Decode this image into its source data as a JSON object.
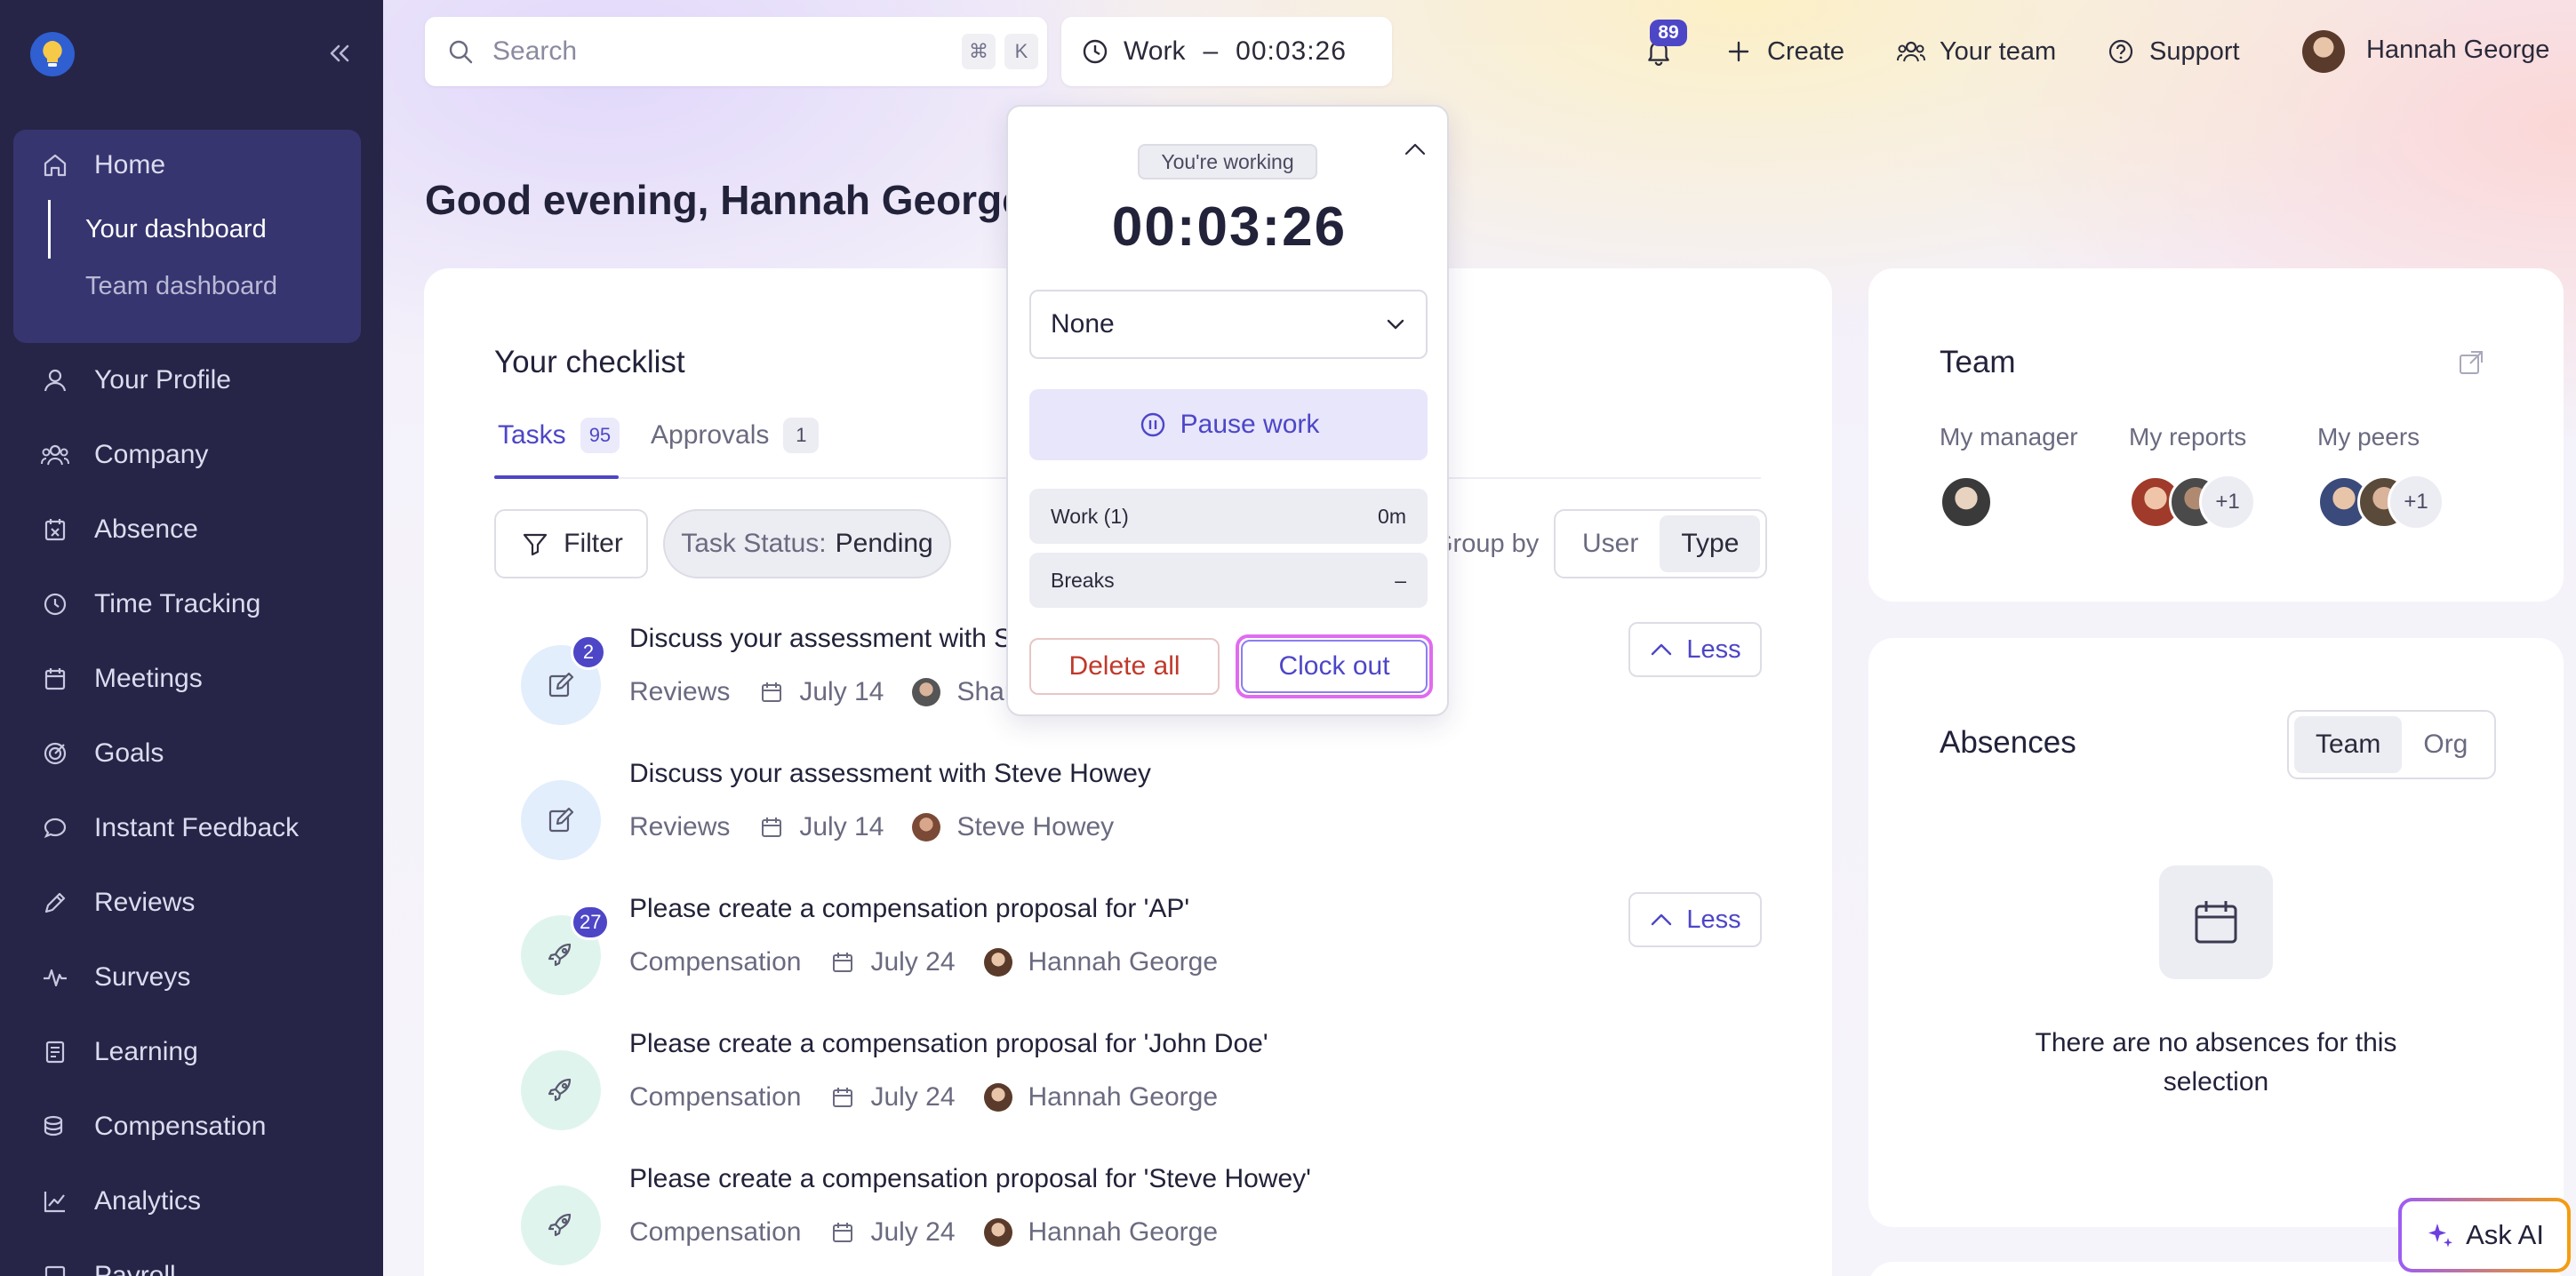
{
  "sidebar": {
    "items": [
      {
        "label": "Home",
        "icon": "home-icon"
      },
      {
        "label": "Your Profile",
        "icon": "user-icon"
      },
      {
        "label": "Company",
        "icon": "users-icon"
      },
      {
        "label": "Absence",
        "icon": "calendar-x-icon"
      },
      {
        "label": "Time Tracking",
        "icon": "clock-icon"
      },
      {
        "label": "Meetings",
        "icon": "calendar-icon"
      },
      {
        "label": "Goals",
        "icon": "target-icon"
      },
      {
        "label": "Instant Feedback",
        "icon": "chat-bubble-icon"
      },
      {
        "label": "Reviews",
        "icon": "pencil-icon"
      },
      {
        "label": "Surveys",
        "icon": "pulse-icon"
      },
      {
        "label": "Learning",
        "icon": "book-icon"
      },
      {
        "label": "Compensation",
        "icon": "coins-icon"
      },
      {
        "label": "Analytics",
        "icon": "chart-icon"
      },
      {
        "label": "Payroll",
        "icon": "payroll-icon"
      }
    ],
    "home_sub": [
      {
        "label": "Your dashboard",
        "active": true
      },
      {
        "label": "Team dashboard",
        "active": false
      }
    ]
  },
  "topbar": {
    "search_placeholder": "Search",
    "shortcut_keys": [
      "⌘",
      "K"
    ],
    "timer_label": "Work",
    "timer_sep": "–",
    "timer_value": "00:03:26",
    "notifications_count": "89",
    "create": "Create",
    "your_team": "Your team",
    "support": "Support",
    "user_name": "Hannah George"
  },
  "greeting": "Good evening, Hannah George!",
  "checklist": {
    "title": "Your checklist",
    "tabs": [
      {
        "label": "Tasks",
        "count": "95",
        "active": true
      },
      {
        "label": "Approvals",
        "count": "1",
        "active": false
      }
    ],
    "filter_label": "Filter",
    "status_chip": {
      "key": "Task Status:",
      "value": "Pending"
    },
    "group_by_label": "Group by",
    "group_by_options": [
      "User",
      "Type"
    ],
    "group_by_selected": "Type",
    "less_label": "Less",
    "tasks": [
      {
        "title": "Discuss your assessment with Sh",
        "category": "Reviews",
        "date": "July 14",
        "person": "Shan",
        "badge": "2",
        "icon": "edit-icon"
      },
      {
        "title": "Discuss your assessment with Steve Howey",
        "category": "Reviews",
        "date": "July 14",
        "person": "Steve Howey",
        "badge": "",
        "icon": "edit-icon"
      },
      {
        "title": "Please create a compensation proposal for 'AP'",
        "category": "Compensation",
        "date": "July 24",
        "person": "Hannah George",
        "badge": "27",
        "icon": "rocket-icon"
      },
      {
        "title": "Please create a compensation proposal for 'John Doe'",
        "category": "Compensation",
        "date": "July 24",
        "person": "Hannah George",
        "badge": "",
        "icon": "rocket-icon"
      },
      {
        "title": "Please create a compensation proposal for 'Steve Howey'",
        "category": "Compensation",
        "date": "July 24",
        "person": "Hannah George",
        "badge": "",
        "icon": "rocket-icon"
      }
    ]
  },
  "team": {
    "title": "Team",
    "my_manager": "My manager",
    "my_reports": "My reports",
    "my_peers": "My peers",
    "reports_more": "+1",
    "peers_more": "+1"
  },
  "absences": {
    "title": "Absences",
    "toggle": [
      "Team",
      "Org"
    ],
    "selected": "Team",
    "empty_text": "There are no absences for this selection"
  },
  "ask_ai": "Ask AI",
  "popover": {
    "status": "You're working",
    "time": "00:03:26",
    "select_value": "None",
    "pause_label": "Pause work",
    "rows": [
      {
        "label": "Work (1)",
        "value": "0m"
      },
      {
        "label": "Breaks",
        "value": "–"
      }
    ],
    "delete_label": "Delete all",
    "clockout_label": "Clock out"
  },
  "colors": {
    "sidebar_bg": "#262547",
    "accent": "#4d46c7",
    "danger": "#c0392b"
  }
}
